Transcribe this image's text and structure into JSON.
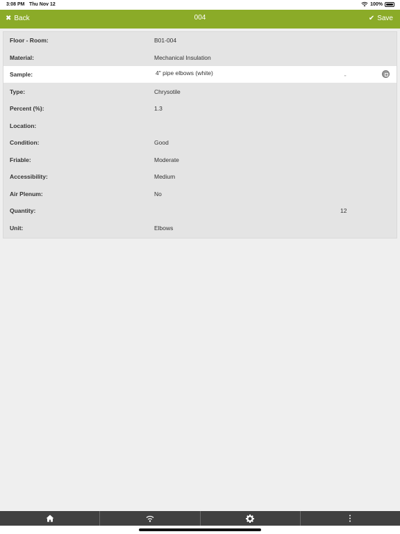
{
  "status": {
    "time": "3:08 PM",
    "date": "Thu Nov 12",
    "battery": "100%"
  },
  "nav": {
    "back_label": "Back",
    "title": "004",
    "save_label": "Save",
    "bar_color": "#8bab28"
  },
  "form": {
    "rows": [
      {
        "label": "Floor - Room:",
        "value": "B01-004"
      },
      {
        "label": "Material:",
        "value": "Mechanical Insulation"
      },
      {
        "label": "Sample:",
        "value": "4\" pipe elbows (white)",
        "ditto": "\""
      },
      {
        "label": "Type:",
        "value": "Chrysotile"
      },
      {
        "label": "Percent (%):",
        "value": "1.3"
      },
      {
        "label": "Location:",
        "value": ""
      },
      {
        "label": "Condition:",
        "value": "Good"
      },
      {
        "label": "Friable:",
        "value": "Moderate"
      },
      {
        "label": "Accessibility:",
        "value": "Medium"
      },
      {
        "label": "Air Plenum:",
        "value": "No"
      },
      {
        "label": "Quantity:",
        "value": "12"
      },
      {
        "label": "Unit:",
        "value": "Elbows"
      }
    ]
  },
  "tabbar": {
    "tabs": [
      "home-icon",
      "wifi-icon",
      "gear-icon",
      "more-vertical-icon"
    ]
  }
}
